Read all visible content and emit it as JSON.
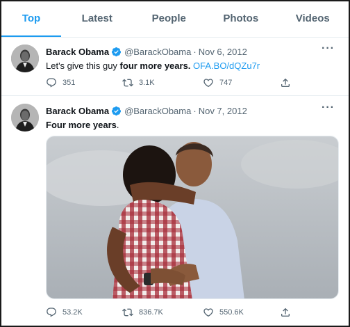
{
  "tabs": [
    {
      "label": "Top",
      "active": true
    },
    {
      "label": "Latest",
      "active": false
    },
    {
      "label": "People",
      "active": false
    },
    {
      "label": "Photos",
      "active": false
    },
    {
      "label": "Videos",
      "active": false
    }
  ],
  "colors": {
    "accent": "#1d9bf0",
    "muted": "#536471",
    "text": "#0f1419"
  },
  "tweets": [
    {
      "name": "Barack Obama",
      "verified_icon": "verified-badge-icon",
      "handle": "@BarackObama",
      "separator": "·",
      "date": "Nov 6, 2012",
      "more_label": "···",
      "text_prefix": "Let's give this guy ",
      "text_bold": "four more years.",
      "text_link": "OFA.BO/dQZu7r",
      "replies": "351",
      "retweets": "3.1K",
      "likes": "747"
    },
    {
      "name": "Barack Obama",
      "verified_icon": "verified-badge-icon",
      "handle": "@BarackObama",
      "separator": "·",
      "date": "Nov 7, 2012",
      "more_label": "···",
      "text_bold": "Four more years",
      "text_suffix": ".",
      "replies": "53.2K",
      "retweets": "836.7K",
      "likes": "550.6K"
    }
  ]
}
